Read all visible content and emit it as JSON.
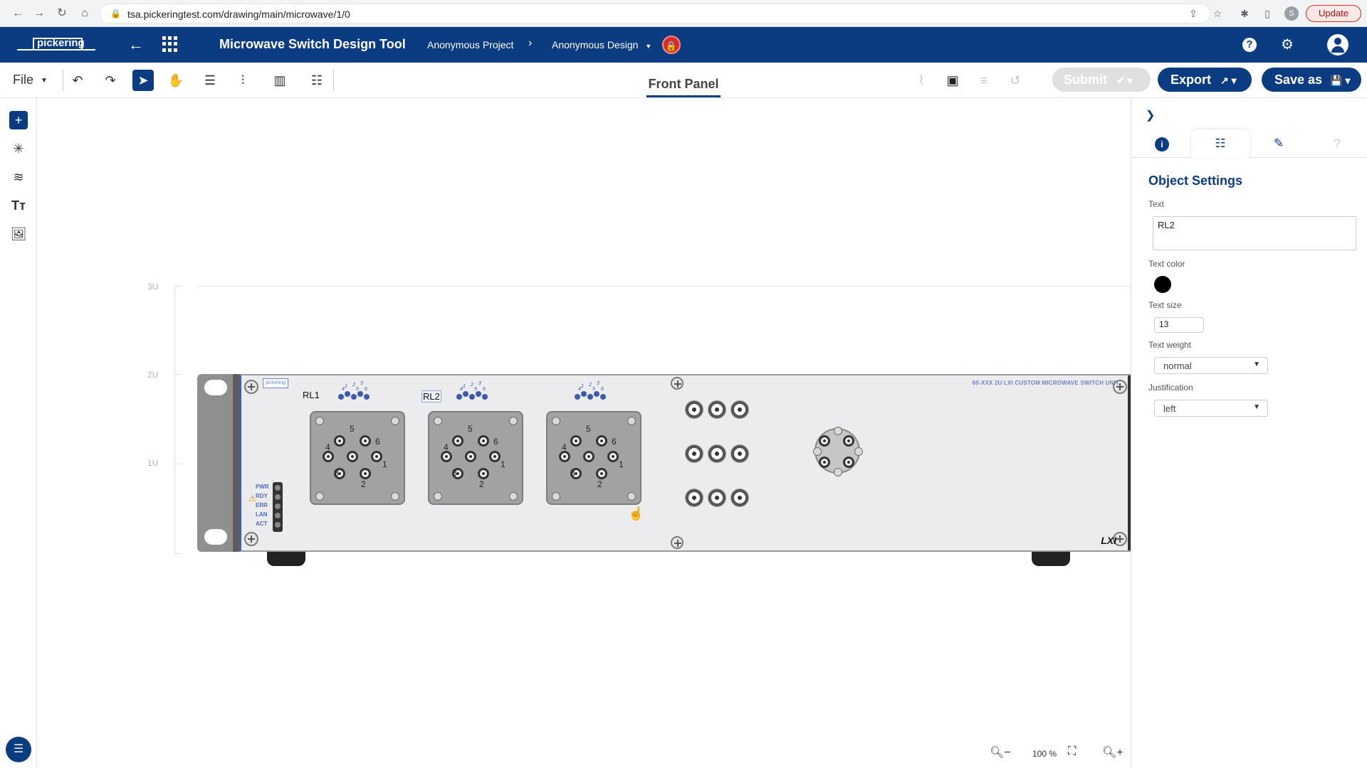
{
  "browser": {
    "url": "tsa.pickeringtest.com/drawing/main/microwave/1/0",
    "profile_initial": "S",
    "update_label": "Update"
  },
  "header": {
    "logo_text": "pickering",
    "title": "Microwave Switch Design Tool",
    "project": "Anonymous Project",
    "design": "Anonymous Design",
    "breadcrumb_separator": "›"
  },
  "toolbar": {
    "file_label": "File",
    "active_tab": "Front Panel",
    "submit_label": "Submit",
    "export_label": "Export",
    "save_as_label": "Save as"
  },
  "canvas": {
    "u_labels": [
      "3U",
      "2U",
      "1U"
    ],
    "product_title": "60-XXX 2U LXI CUSTOM MICROWAVE SWITCH UNIT",
    "panel_logo_text": "pickering",
    "led_labels": [
      "PWR",
      "RDY",
      "ERR",
      "LAN",
      "ACT"
    ],
    "relays": [
      {
        "label": "RL1",
        "selected": false,
        "pin_numbers": [
          "1",
          "2",
          "3",
          "4",
          "5",
          "6"
        ]
      },
      {
        "label": "RL2",
        "selected": true,
        "pin_numbers": [
          "1",
          "2",
          "3",
          "4",
          "5",
          "6"
        ]
      },
      {
        "label": "",
        "selected": false,
        "pin_numbers": [
          "1",
          "2",
          "3",
          "4",
          "5",
          "6"
        ]
      }
    ],
    "port_numbers": [
      "5",
      "6",
      "4",
      "1",
      "3",
      "2"
    ],
    "lxi_label": "LXI"
  },
  "zoom": {
    "level": "100 %"
  },
  "right_panel": {
    "title": "Object Settings",
    "text_label": "Text",
    "text_value": "RL2",
    "text_color_label": "Text color",
    "text_color": "#000000",
    "text_size_label": "Text size",
    "text_size": "13",
    "text_weight_label": "Text weight",
    "text_weight": "normal",
    "justification_label": "Justification",
    "justification": "left"
  },
  "colors": {
    "brand": "#0b3c82",
    "lock": "#d32f2f"
  }
}
